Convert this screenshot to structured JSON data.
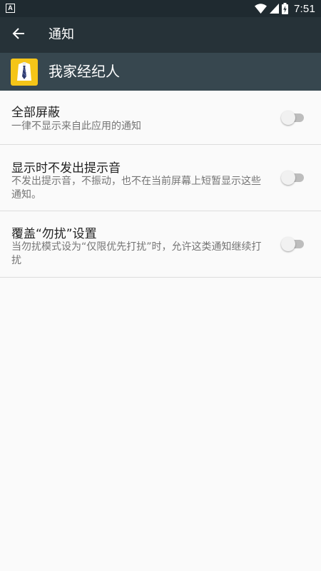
{
  "status_bar": {
    "notification_badge": "A",
    "time": "7:51",
    "icons": [
      "wifi-icon",
      "cellular-signal-icon",
      "battery-charging-icon"
    ]
  },
  "toolbar": {
    "back_icon": "arrow-back-icon",
    "title": "通知"
  },
  "app": {
    "icon": "shirt-tie-app-icon",
    "name": "我家经纪人"
  },
  "settings": [
    {
      "title": "全部屏蔽",
      "summary": "一律不显示来自此应用的通知",
      "enabled": false
    },
    {
      "title": "显示时不发出提示音",
      "summary": "不发出提示音，不振动，也不在当前屏幕上短暂显示这些通知。",
      "enabled": false
    },
    {
      "title": "覆盖“勿扰”设置",
      "summary": "当勿扰模式设为“仅限优先打扰”时，允许这类通知继续打扰",
      "enabled": false
    }
  ],
  "colors": {
    "status_bar": "#1f2a30",
    "toolbar": "#263238",
    "app_header": "#37474f",
    "app_icon_bg": "#f5c518",
    "background": "#fafafa",
    "divider": "#dddddd"
  }
}
